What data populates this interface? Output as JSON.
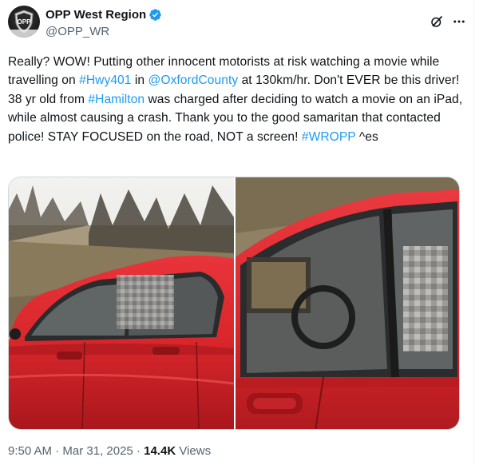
{
  "account": {
    "display_name": "OPP West Region",
    "handle": "@OPP_WR",
    "avatar_text": "OPP",
    "verified": true
  },
  "tweet": {
    "segments": [
      {
        "text": "Really? WOW! Putting other innocent motorists at risk watching a movie while travelling on ",
        "link": false
      },
      {
        "text": "#Hwy401",
        "link": true
      },
      {
        "text": " in ",
        "link": false
      },
      {
        "text": "@OxfordCounty",
        "link": true
      },
      {
        "text": " at 130km/hr. Don't EVER be this driver! 38 yr old from ",
        "link": false
      },
      {
        "text": "#Hamilton",
        "link": true
      },
      {
        "text": " was charged after deciding to watch a movie on an iPad, while almost causing a crash. Thank you to the good samaritan that contacted police! STAY FOCUSED on the road, NOT a screen! ",
        "link": false
      },
      {
        "text": "#WROPP",
        "link": true
      },
      {
        "text": " ^es",
        "link": false
      }
    ]
  },
  "media": {
    "left_photo_label": "red car photo from side",
    "right_photo_label": "red car window close-up with iPad"
  },
  "meta": {
    "time": "9:50 AM",
    "separator1": " · ",
    "date": "Mar 31, 2025",
    "separator2": " · ",
    "views_count": "14.4K",
    "views_label": " Views"
  },
  "colors": {
    "link": "#1d9bf0",
    "secondary_text": "#536471",
    "car_red": "#d8262b",
    "verified_blue": "#1d9bf0"
  },
  "icons": {
    "verified": "verified-badge-icon",
    "grok": "grok-icon",
    "more": "more-horizontal-icon"
  }
}
